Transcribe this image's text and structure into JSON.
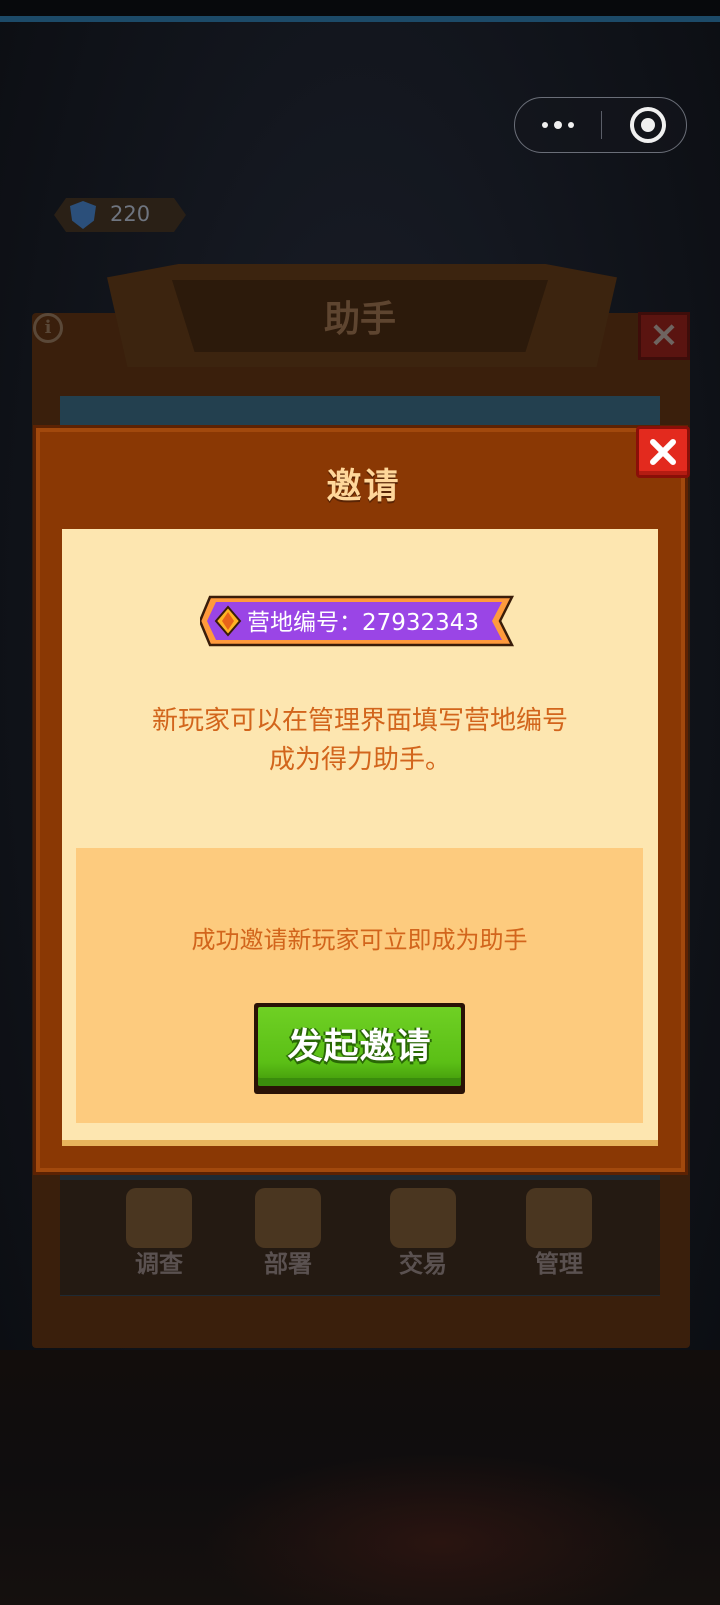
{
  "top_bar": {
    "capsule_more_icon": "more-dots-icon",
    "capsule_close_icon": "target-circle-icon"
  },
  "background": {
    "currency_value": "220",
    "panel_title": "助手",
    "info_icon": "info-icon",
    "close_icon": "close-icon",
    "nav": [
      {
        "label": "调查",
        "icon": "magnifier-icon"
      },
      {
        "label": "部署",
        "icon": "map-pin-icon"
      },
      {
        "label": "交易",
        "icon": "shop-icon"
      },
      {
        "label": "管理",
        "icon": "gear-icon"
      }
    ]
  },
  "modal": {
    "title": "邀请",
    "close_icon": "close-icon",
    "camp_badge": "营地编号：27932343",
    "description_line1": "新玩家可以在管理界面填写营地编号",
    "description_line2": "成为得力助手。",
    "sub_text": "成功邀请新玩家可立即成为助手",
    "invite_button": "发起邀请"
  },
  "colors": {
    "modal_frame": "#8a3804",
    "modal_body": "#fde6b0",
    "sub_panel": "#fdcb7e",
    "text_orange": "#d2651c",
    "badge_purple": "#9a45e6",
    "button_green": "#5bbf16",
    "close_red": "#e32a1e"
  }
}
